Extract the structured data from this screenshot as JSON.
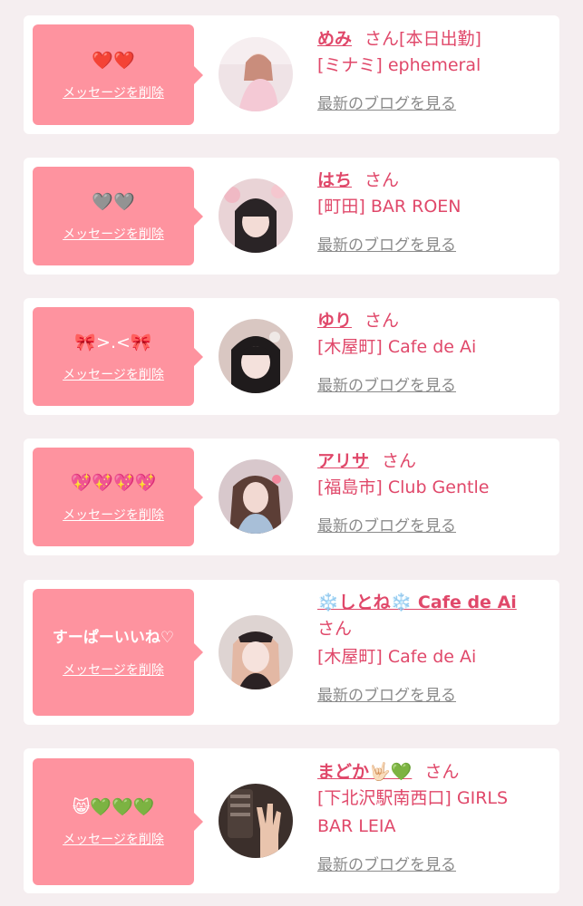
{
  "delete_label": "メッセージを削除",
  "blog_label": "最新のブログを見る",
  "honorific": "さん",
  "cards": [
    {
      "message": "❤️❤️",
      "name": "めみ",
      "tag": "[本日出勤]",
      "shop": "[ミナミ] ephemeral",
      "avatar": "avatar-photo-1"
    },
    {
      "message": "🩶🩶",
      "name": "はち",
      "shop": "[町田] BAR ROEN",
      "avatar": "avatar-photo-2"
    },
    {
      "message": "🎀>.<🎀",
      "name": "ゆり",
      "shop": "[木屋町] Cafe de Ai",
      "avatar": "avatar-photo-3"
    },
    {
      "message": "💖💖💖💖",
      "name": "アリサ",
      "shop": "[福島市] Club Gentle",
      "avatar": "avatar-photo-4"
    },
    {
      "message": "すーぱーいいね♡",
      "name": "❄️しとね❄️ Cafe de Ai",
      "shop": "[木屋町] Cafe de Ai",
      "avatar": "avatar-photo-5"
    },
    {
      "message": "😸💚💚💚",
      "name": "まどか🤟🏻💚",
      "shop_line1": "[下北沢駅南西口] GIRLS",
      "shop_line2": "BAR LEIA",
      "avatar": "avatar-photo-6"
    }
  ],
  "colors": {
    "bubble": "#fe939f",
    "accent": "#e0486a",
    "link_gray": "#8a8a8a",
    "background": "#f5eef0"
  }
}
